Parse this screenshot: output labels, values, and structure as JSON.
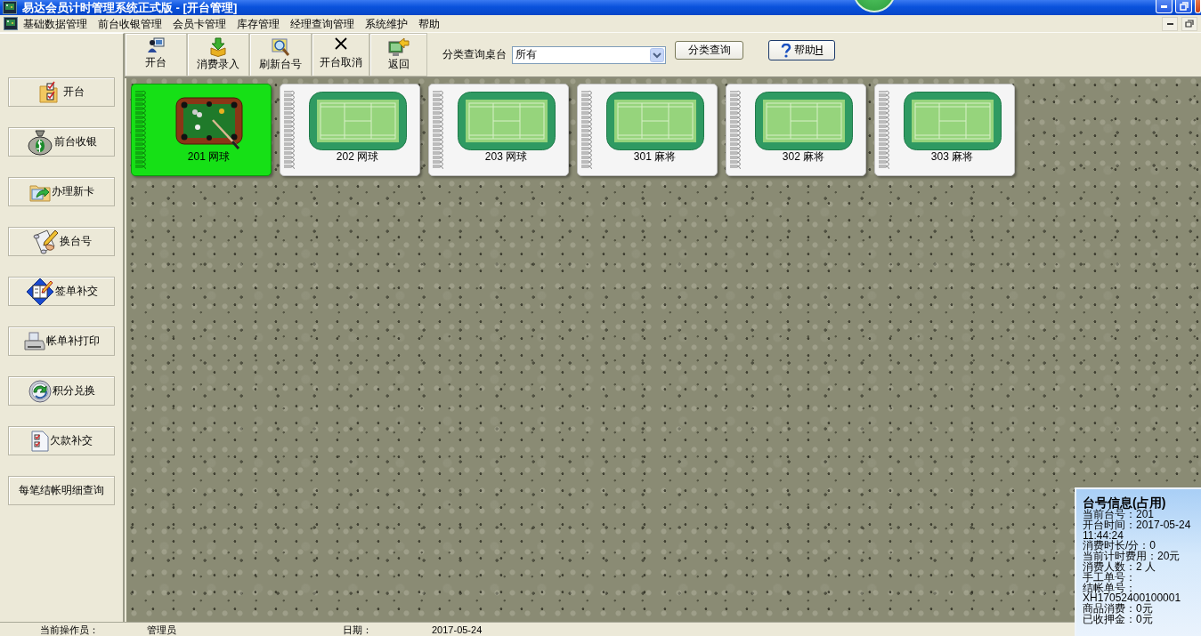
{
  "window": {
    "title": "易达会员计时管理系统正式版 - [开台管理]"
  },
  "menu": [
    "基础数据管理",
    "前台收银管理",
    "会员卡管理",
    "库存管理",
    "经理查询管理",
    "系统维护",
    "帮助"
  ],
  "toolbar": {
    "buttons": [
      {
        "label": "开台",
        "kind": "open"
      },
      {
        "label": "消费录入",
        "kind": "input"
      },
      {
        "label": "刷新台号",
        "kind": "refresh"
      },
      {
        "label": "开台取消",
        "kind": "cancel"
      },
      {
        "label": "返回",
        "kind": "back"
      }
    ],
    "filter_label": "分类查询桌台",
    "filter_value": "所有",
    "filter_button": "分类查询",
    "help_button": {
      "label": "帮助",
      "shortcut": "H"
    }
  },
  "sidebar": {
    "items": [
      {
        "label": "开台",
        "kind": "open"
      },
      {
        "label": "前台收银",
        "kind": "cashier"
      },
      {
        "label": "办理新卡",
        "kind": "card"
      },
      {
        "label": "换台号",
        "kind": "swap"
      },
      {
        "label": "签单补交",
        "kind": "sign"
      },
      {
        "label": "帐单补打印",
        "kind": "print"
      },
      {
        "label": "积分兑换",
        "kind": "points"
      },
      {
        "label": "欠款补交",
        "kind": "debt"
      },
      {
        "label": "每笔结帐明细查询",
        "kind": "text"
      }
    ]
  },
  "tables": [
    {
      "label": "201 网球",
      "occupied": true
    },
    {
      "label": "202 网球",
      "occupied": false
    },
    {
      "label": "203 网球",
      "occupied": false
    },
    {
      "label": "301 麻将",
      "occupied": false
    },
    {
      "label": "302 麻将",
      "occupied": false
    },
    {
      "label": "303 麻将",
      "occupied": false
    }
  ],
  "info_panel": {
    "title": "台号信息(占用)",
    "rows": [
      {
        "label": "当前台号：",
        "value": "201"
      },
      {
        "label": "开台时间：",
        "value": "2017-05-24 11:44:24"
      },
      {
        "label": "消费时长/分：",
        "value": "0"
      },
      {
        "label": "当前计时费用：",
        "value": "20元"
      },
      {
        "label": "消费人数：",
        "value": "2 人"
      },
      {
        "label": "手工单号："
      },
      {
        "label": "结帐单号：",
        "value": "XH17052400100001"
      },
      {
        "label": "商品消费：",
        "value": "0元"
      },
      {
        "label": "已收押金：",
        "value": "0元"
      }
    ]
  },
  "status_bar": [
    {
      "label": "当前操作员：",
      "value": "管理员"
    },
    {
      "label": "日期：",
      "value": "2017-05-24"
    }
  ]
}
